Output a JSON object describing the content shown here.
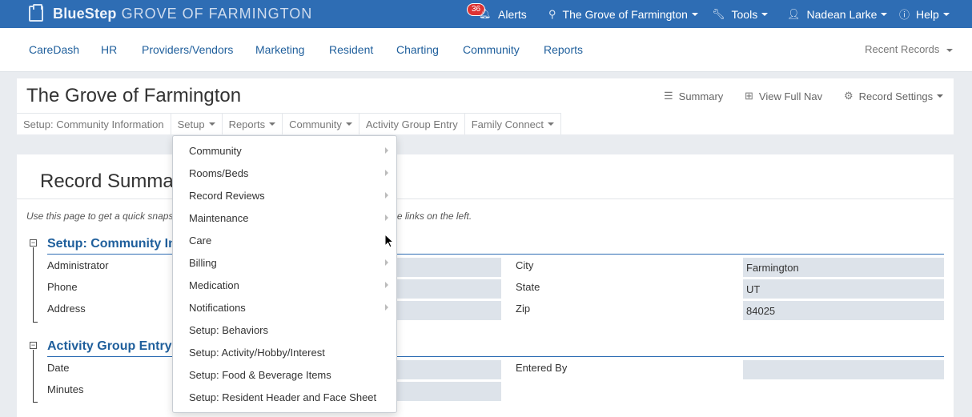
{
  "topbar": {
    "brand_name": "BlueStep",
    "brand_sub": "GROVE OF FARMINGTON",
    "alerts_count": "36",
    "alerts_label": "Alerts",
    "location_label": "The Grove of Farmington",
    "tools_label": "Tools",
    "user_label": "Nadean Larke",
    "help_label": "Help"
  },
  "mainnav": {
    "items": [
      "CareDash",
      "HR",
      "Providers/Vendors",
      "Marketing",
      "Resident",
      "Charting",
      "Community",
      "Reports"
    ],
    "recent_label": "Recent Records"
  },
  "record": {
    "title": "The Grove of Farmington",
    "summary_label": "Summary",
    "view_full_nav_label": "View Full Nav",
    "record_settings_label": "Record Settings",
    "subnav": [
      "Setup: Community Information",
      "Setup",
      "Reports",
      "Community",
      "Activity Group Entry",
      "Family Connect"
    ]
  },
  "summary": {
    "title": "Record Summary",
    "hint_left": "Use this page to get a quick snapsh",
    "hint_right": "use the links on the left.",
    "section1": {
      "title": "Setup: Community Info",
      "labels": [
        "Administrator",
        "Phone",
        "Address"
      ],
      "right_labels": [
        "City",
        "State",
        "Zip"
      ],
      "right_values": [
        "Farmington",
        "UT",
        "84025"
      ]
    },
    "section2": {
      "title": "Activity Group Entry",
      "labels": [
        "Date",
        "Minutes"
      ],
      "right_labels": [
        "Entered By"
      ],
      "right_values": [
        ""
      ]
    }
  },
  "dropdown": {
    "items": [
      {
        "label": "Community",
        "submenu": true
      },
      {
        "label": "Rooms/Beds",
        "submenu": true
      },
      {
        "label": "Record Reviews",
        "submenu": true
      },
      {
        "label": "Maintenance",
        "submenu": true
      },
      {
        "label": "Care",
        "submenu": true
      },
      {
        "label": "Billing",
        "submenu": true
      },
      {
        "label": "Medication",
        "submenu": true
      },
      {
        "label": "Notifications",
        "submenu": true
      },
      {
        "label": "Setup: Behaviors",
        "submenu": false
      },
      {
        "label": "Setup: Activity/Hobby/Interest",
        "submenu": false
      },
      {
        "label": "Setup: Food & Beverage Items",
        "submenu": false
      },
      {
        "label": "Setup: Resident Header and Face Sheet",
        "submenu": false
      }
    ]
  },
  "colors": {
    "topbar": "#2e6db4",
    "link": "#1f5f9c",
    "field_bg": "#dde3ea"
  }
}
